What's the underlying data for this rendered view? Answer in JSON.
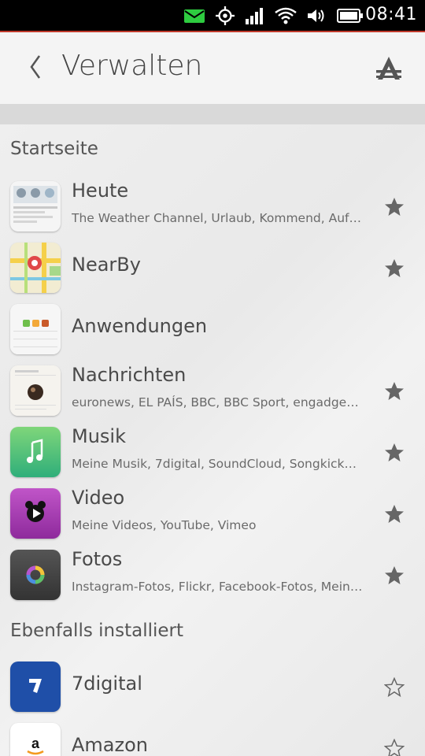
{
  "status_bar": {
    "time": "08:41",
    "icons": [
      "message-icon",
      "location-icon",
      "signal-icon",
      "wifi-icon",
      "volume-icon",
      "battery-icon"
    ]
  },
  "header": {
    "title": "Verwalten",
    "back_icon": "chevron-left-icon",
    "store_icon": "app-store-icon"
  },
  "sections": [
    {
      "title": "Startseite",
      "items": [
        {
          "name": "Heute",
          "subtitle": "The Weather Channel, Urlaub, Kommend, Aufgab…",
          "favorite": true,
          "icon": "today-scope-icon"
        },
        {
          "name": "NearBy",
          "subtitle": "",
          "favorite": true,
          "icon": "nearby-map-icon"
        },
        {
          "name": "Anwendungen",
          "subtitle": "",
          "favorite": false,
          "icon": "apps-scope-icon"
        },
        {
          "name": "Nachrichten",
          "subtitle": "euronews, EL PAÍS, BBC, BBC Sport, engadget, cn…",
          "favorite": true,
          "icon": "news-icon"
        },
        {
          "name": "Musik",
          "subtitle": "Meine Musik, 7digital, SoundCloud, Songkick…",
          "favorite": true,
          "icon": "music-icon"
        },
        {
          "name": "Video",
          "subtitle": "Meine Videos, YouTube, Vimeo",
          "favorite": true,
          "icon": "video-icon"
        },
        {
          "name": "Fotos",
          "subtitle": "Instagram-Fotos, Flickr, Facebook-Fotos, Mein…",
          "favorite": true,
          "icon": "photos-icon"
        }
      ]
    },
    {
      "title": "Ebenfalls installiert",
      "items": [
        {
          "name": "7digital",
          "subtitle": "",
          "favorite": false,
          "icon": "7digital-icon"
        },
        {
          "name": "Amazon",
          "subtitle": "",
          "favorite": false,
          "icon": "amazon-icon"
        }
      ]
    }
  ],
  "colors": {
    "statusbar": "#000000",
    "accent_line": "#c0392b",
    "header_bg": "#f4f4f4",
    "star_filled": "#666666"
  }
}
